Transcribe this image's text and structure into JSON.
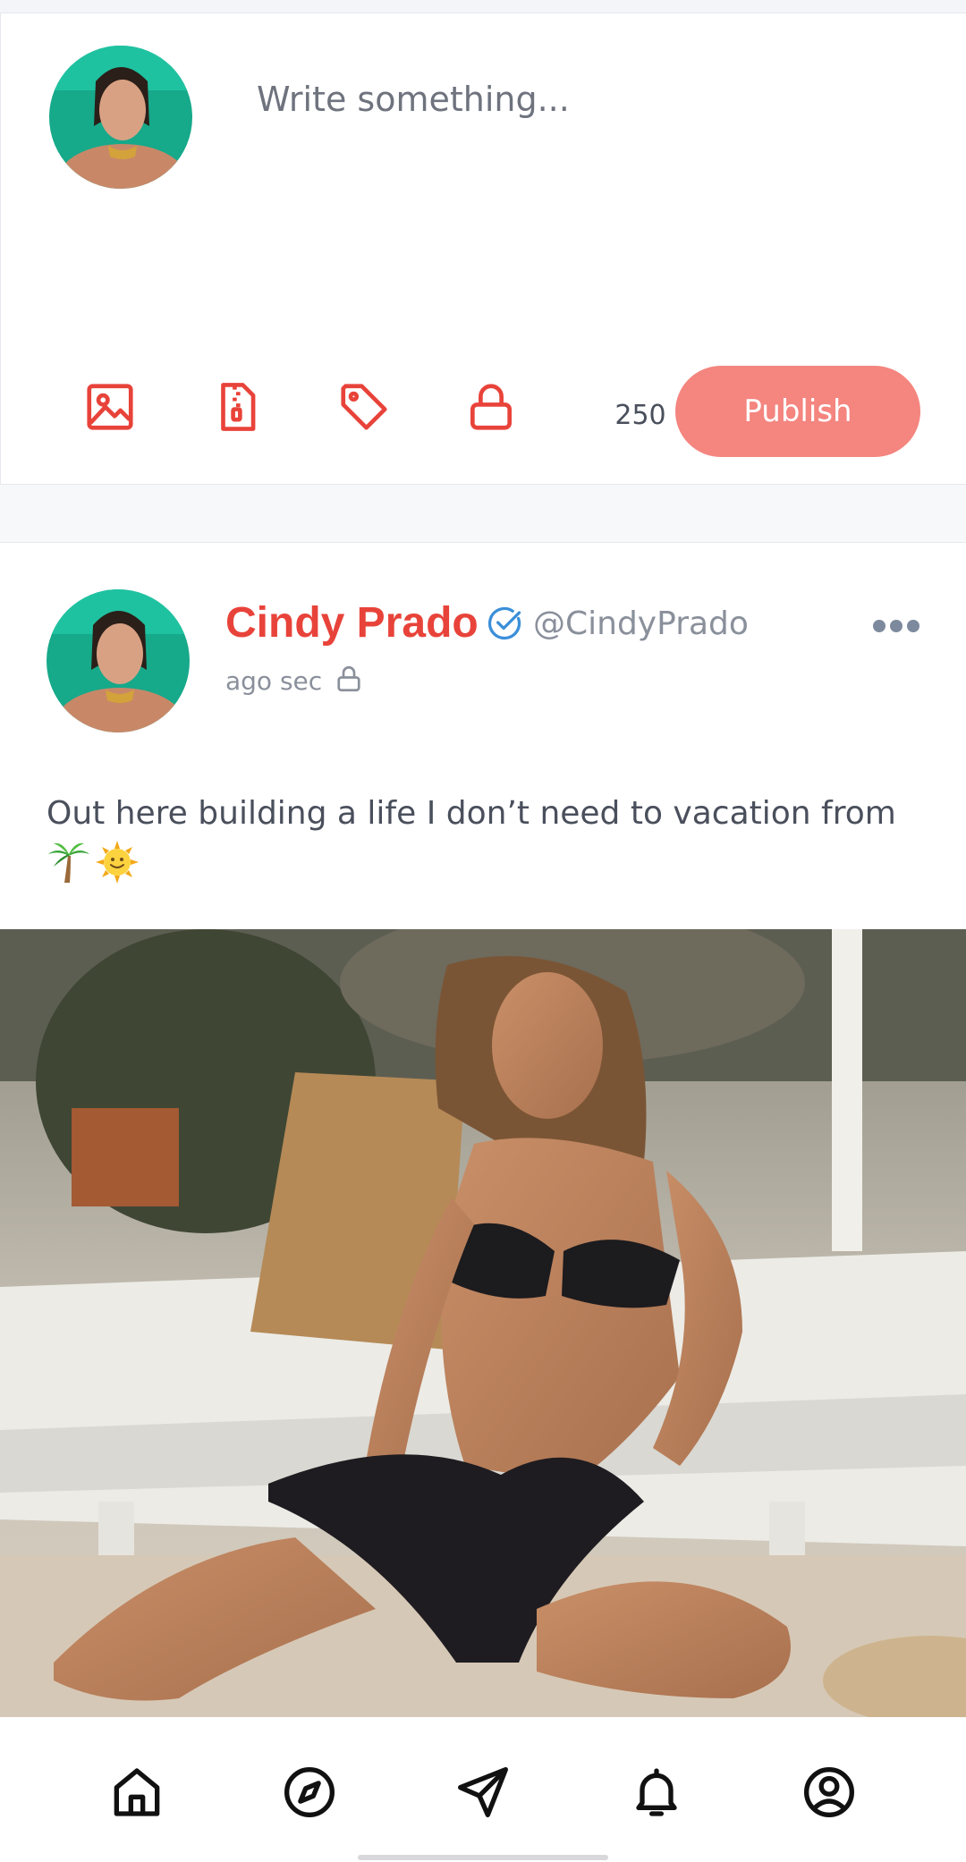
{
  "composer": {
    "placeholder": "Write something...",
    "char_count": "250",
    "publish_label": "Publish",
    "tools": [
      "image-icon",
      "zip-file-icon",
      "tag-icon",
      "lock-icon"
    ]
  },
  "post": {
    "author_name": "Cindy Prado",
    "author_handle": "@CindyPrado",
    "time": "ago sec",
    "text": "Out here building a life I don’t need to vacation from",
    "emojis": [
      "palm-tree-icon",
      "sun-face-icon"
    ]
  },
  "nav": {
    "items": [
      "home-icon",
      "compass-icon",
      "send-icon",
      "bell-icon",
      "profile-icon"
    ]
  },
  "colors": {
    "accent": "#e8433a",
    "publish_bg": "#f4857f",
    "verified": "#3b8fd9",
    "muted": "#8a909b"
  }
}
